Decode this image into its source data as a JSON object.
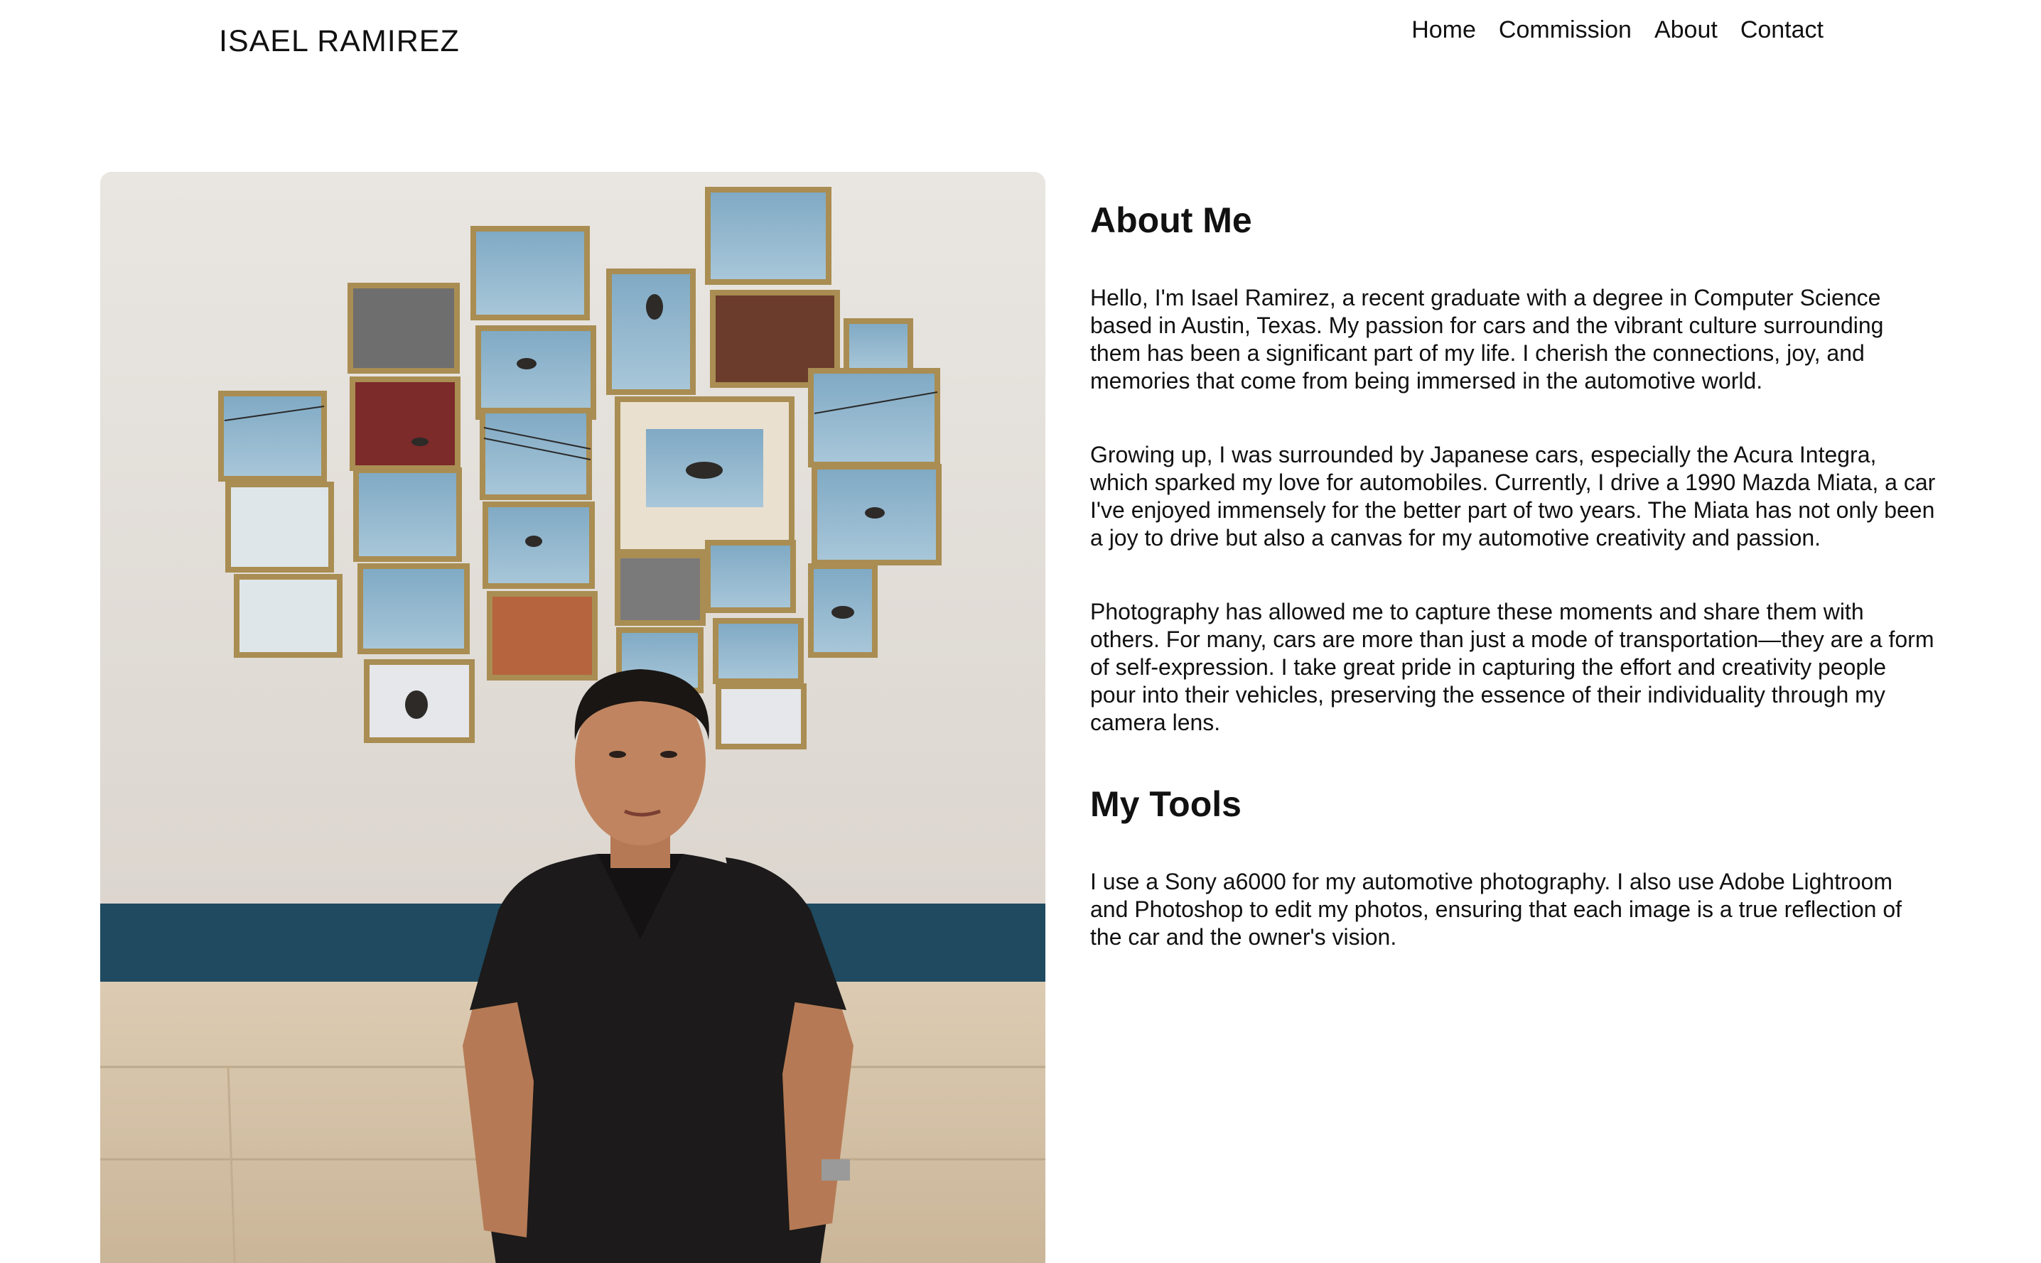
{
  "header": {
    "site_title": "ISAEL RAMIREZ",
    "nav": [
      {
        "label": "Home"
      },
      {
        "label": "Commission"
      },
      {
        "label": "About"
      },
      {
        "label": "Contact"
      }
    ]
  },
  "main": {
    "photo": {
      "alt": "Portrait photo"
    },
    "about_heading": "About Me",
    "paragraphs": [
      "Hello, I'm Isael Ramirez, a recent graduate with a degree in Computer Science based in Austin, Texas. My passion for cars and the vibrant culture surrounding them has been a significant part of my life. I cherish the connections, joy, and memories that come from being immersed in the automotive world.",
      "Growing up, I was surrounded by Japanese cars, especially the Acura Integra, which sparked my love for automobiles. Currently, I drive a 1990 Mazda Miata, a car I've enjoyed immensely for the better part of two years. The Miata has not only been a joy to drive but also a canvas for my automotive creativity and passion.",
      "Photography has allowed me to capture these moments and share them with others. For many, cars are more than just a mode of transportation—they are a form of self-expression. I take great pride in capturing the effort and creativity people pour into their vehicles, preserving the essence of their individuality through my camera lens."
    ],
    "tools_heading": "My Tools",
    "tools_paragraph": "I use a Sony a6000 for my automotive photography. I also use Adobe Lightroom and Photoshop to edit my photos, ensuring that each image is a true reflection of the car and the owner's vision."
  },
  "colors": {
    "text": "#111111",
    "background": "#ffffff",
    "wall": "#e7e3de",
    "wall_trim": "#1f4a60",
    "bench": "#d2bfa6",
    "shirt": "#1c1a1a",
    "sky": "#8fb4cc",
    "frame_gold": "#b59a5c"
  }
}
